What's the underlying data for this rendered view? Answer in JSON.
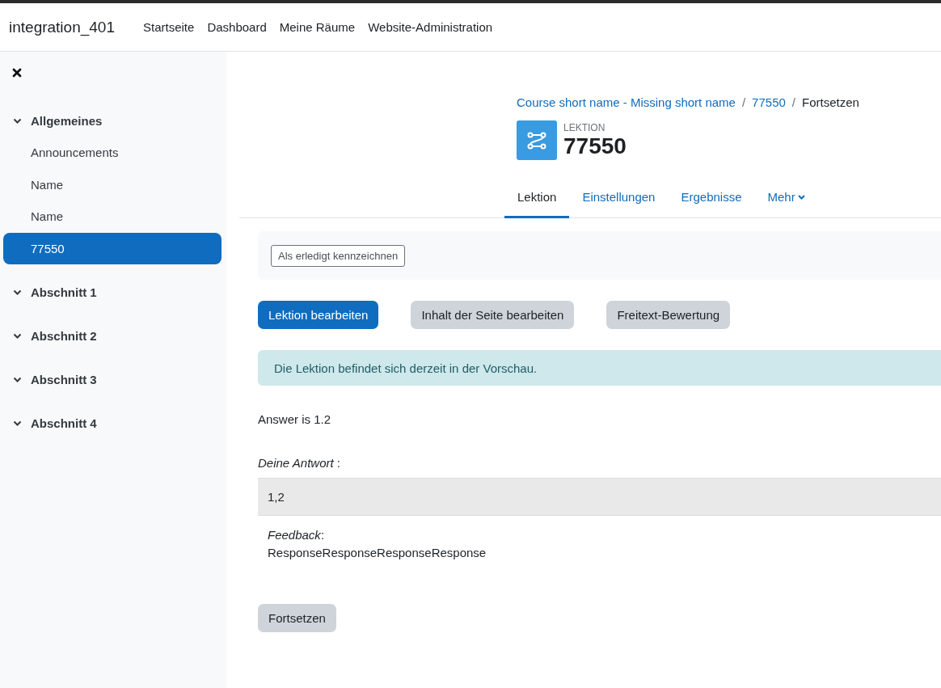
{
  "site_name": "integration_401",
  "nav_links": [
    "Startseite",
    "Dashboard",
    "Meine Räume",
    "Website-Administration"
  ],
  "sidebar": {
    "sections": [
      {
        "title": "Allgemeines",
        "items": [
          {
            "label": "Announcements",
            "selected": false
          },
          {
            "label": "Name",
            "selected": false
          },
          {
            "label": "Name",
            "selected": false
          },
          {
            "label": "77550",
            "selected": true
          }
        ]
      },
      {
        "title": "Abschnitt 1"
      },
      {
        "title": "Abschnitt 2"
      },
      {
        "title": "Abschnitt 3"
      },
      {
        "title": "Abschnitt 4"
      }
    ]
  },
  "breadcrumb": [
    {
      "label": "Course short name - Missing short name",
      "kind": "link"
    },
    {
      "separator": "/",
      "label": "77550",
      "kind": "link"
    },
    {
      "separator": "/",
      "label": "Fortsetzen",
      "kind": "current"
    }
  ],
  "header": {
    "pretitle": "LEKTION",
    "title": "77550"
  },
  "tabs": [
    {
      "label": "Lektion",
      "selected": true,
      "dropdown": false
    },
    {
      "label": "Einstellungen",
      "selected": false,
      "dropdown": false
    },
    {
      "label": "Ergebnisse",
      "selected": false,
      "dropdown": false
    },
    {
      "label": "Mehr",
      "selected": false,
      "dropdown": true
    }
  ],
  "completion_button": "Als erledigt kennzeichnen",
  "action_buttons": [
    {
      "label": "Lektion bearbeiten",
      "kind": "primary"
    },
    {
      "label": "Inhalt der Seite bearbeiten",
      "kind": "secondary"
    },
    {
      "label": "Freitext-Bewertung",
      "kind": "secondary"
    }
  ],
  "alert": "Die Lektion befindet sich derzeit in der Vorschau.",
  "question": "Answer is 1.2",
  "answer_label": "*Deine Antwort* :",
  "answer_value": "1,2",
  "feedback_label": "*Feedback*:",
  "feedback_text": "ResponseResponseResponseResponse",
  "continue_button": "Fortsetzen"
}
